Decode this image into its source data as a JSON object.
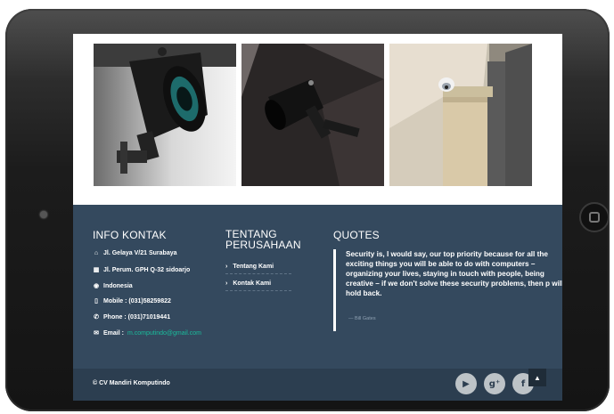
{
  "info_kontak": {
    "title": "INFO KONTAK",
    "items": [
      {
        "icon": "home-icon",
        "glyph": "⌂",
        "text": "Jl. Gelaya V/21 Surabaya"
      },
      {
        "icon": "building-icon",
        "glyph": "▦",
        "text": "Jl. Perum. GPH Q-32 sidoarjo"
      },
      {
        "icon": "globe-icon",
        "glyph": "◉",
        "text": "Indonesia"
      },
      {
        "icon": "mobile-icon",
        "glyph": "▯",
        "text": "Mobile : (031)58259822"
      },
      {
        "icon": "phone-icon",
        "glyph": "✆",
        "text": "Phone : (031)71019441"
      },
      {
        "icon": "envelope-icon",
        "glyph": "✉",
        "label": "Email :",
        "value": "m.computindo@gmail.com"
      }
    ]
  },
  "tentang": {
    "title_line1": "TENTANG",
    "title_line2": "PERUSAHAAN",
    "links": [
      "Tentang Kami",
      "Kontak Kami"
    ]
  },
  "quotes": {
    "title": "QUOTES",
    "text": "Security is, I would say, our top priority because for all the exciting things you will be able to do with computers – organizing your lives, staying in touch with people, being creative – if we don't solve these security problems, then p will hold back.",
    "author": "— Bill Gates"
  },
  "bottom": {
    "copyright": "© CV Mandiri Komputindo",
    "social": [
      {
        "icon": "youtube-icon",
        "glyph": "▶"
      },
      {
        "icon": "google-plus-icon",
        "glyph": "g⁺"
      },
      {
        "icon": "facebook-icon",
        "glyph": "f"
      }
    ],
    "totop_glyph": "▲"
  },
  "colors": {
    "footer_bg": "#34495e",
    "bottombar_bg": "#2c3e50",
    "accent": "#1abc9c"
  }
}
